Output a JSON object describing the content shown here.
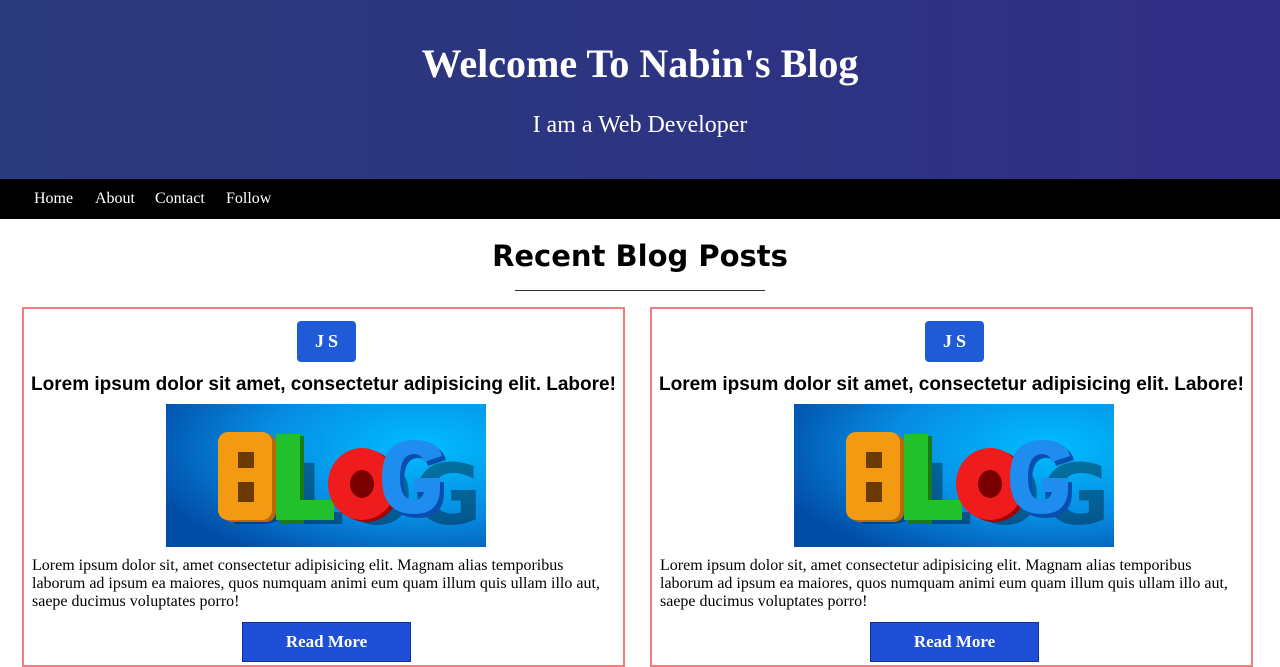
{
  "header": {
    "title": "Welcome To Nabin's Blog",
    "subtitle": "I am a Web Developer"
  },
  "nav": {
    "items": [
      {
        "label": "Home"
      },
      {
        "label": "About"
      },
      {
        "label": "Contact"
      },
      {
        "label": "Follow"
      }
    ]
  },
  "section": {
    "title": "Recent Blog Posts"
  },
  "posts": [
    {
      "badge": "JS",
      "title": "Lorem ipsum dolor sit amet, consectetur adipisicing elit. Labore!",
      "image_text": "BLOG",
      "body": "Lorem ipsum dolor sit, amet consectetur adipisicing elit. Magnam alias temporibus laborum ad ipsum ea maiores, quos numquam animi eum quam illum quis ullam illo aut, saepe ducimus voluptates porro!",
      "button_label": "Read More"
    },
    {
      "badge": "JS",
      "title": "Lorem ipsum dolor sit amet, consectetur adipisicing elit. Labore!",
      "image_text": "BLOG",
      "body": "Lorem ipsum dolor sit, amet consectetur adipisicing elit. Magnam alias temporibus laborum ad ipsum ea maiores, quos numquam animi eum quam illum quis ullam illo aut, saepe ducimus voluptates porro!",
      "button_label": "Read More"
    }
  ],
  "colors": {
    "header_bg": "#2d3382",
    "nav_bg": "#000000",
    "card_border": "#f08080",
    "badge_bg": "#1f5bd6",
    "button_bg": "#1f4fd6"
  }
}
